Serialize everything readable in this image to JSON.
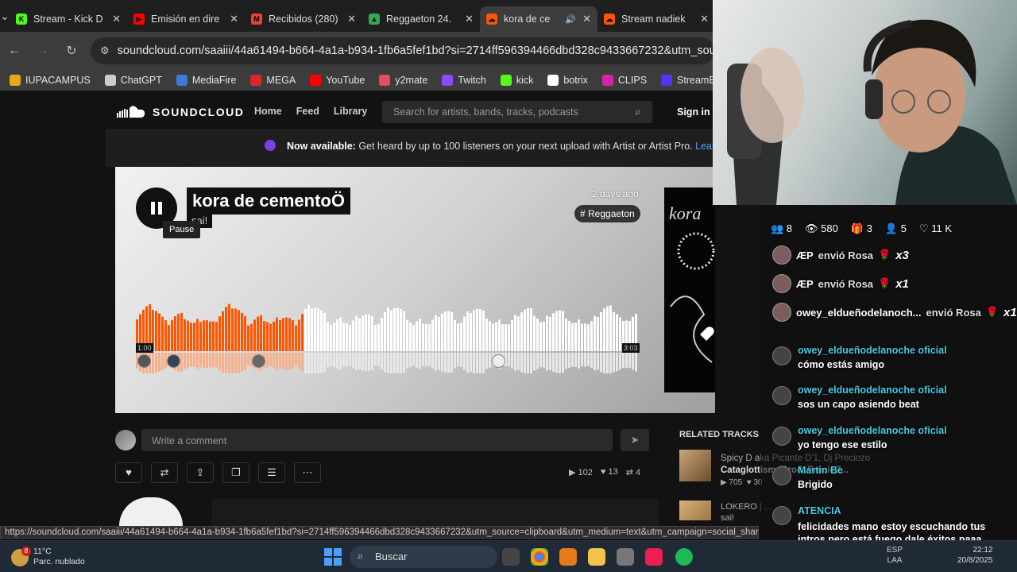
{
  "browser": {
    "tabs": [
      {
        "title": "Stream - Kick D",
        "color": "#53fc18",
        "glyph": "K"
      },
      {
        "title": "Emisión en dire",
        "color": "#ff0000",
        "glyph": "▶"
      },
      {
        "title": "Recibidos (280)",
        "color": "#ea4335",
        "glyph": "M"
      },
      {
        "title": "Reggaeton 24.",
        "color": "#34a853",
        "glyph": "▲"
      },
      {
        "title": "kora de ce",
        "color": "#ff5500",
        "glyph": "☁"
      },
      {
        "title": "Stream nadiek",
        "color": "#ff5500",
        "glyph": "☁"
      }
    ],
    "url": "soundcloud.com/saaiii/44a61494-b664-4a1a-b934-1fb6a5fef1bd?si=2714ff596394466dbd328c9433667232&utm_source",
    "bookmarks": [
      {
        "label": "IUPACAMPUS",
        "color": "#e6a817"
      },
      {
        "label": "ChatGPT",
        "color": "#cccccc"
      },
      {
        "label": "MediaFire",
        "color": "#3d7bd9"
      },
      {
        "label": "MEGA",
        "color": "#d9272e"
      },
      {
        "label": "YouTube",
        "color": "#ff0000"
      },
      {
        "label": "y2mate",
        "color": "#e84a5f"
      },
      {
        "label": "Twitch",
        "color": "#9146ff"
      },
      {
        "label": "kick",
        "color": "#53fc18"
      },
      {
        "label": "botrix",
        "color": "#ffffff"
      },
      {
        "label": "CLIPS",
        "color": "#d6249f"
      },
      {
        "label": "StreamElements",
        "color": "#5533ff"
      }
    ]
  },
  "soundcloud": {
    "logo": "SOUNDCLOUD",
    "nav": [
      "Home",
      "Feed",
      "Library"
    ],
    "search_placeholder": "Search for artists, bands, tracks, podcasts",
    "sign_in": "Sign in",
    "banner_bold": "Now available:",
    "banner_text": " Get heard by up to 100 listeners on your next upload with Artist or Artist Pro. ",
    "banner_link": "Learn M",
    "track": {
      "title": "kora de cementoÖ",
      "artist": "sai!",
      "uploaded": "2 days ago",
      "tag": "# Reggaeton",
      "tooltip": "Pause",
      "elapsed": "1:00",
      "duration": "3:03",
      "progress": 0.33
    },
    "comment_placeholder": "Write a comment",
    "stats": {
      "plays": "102",
      "likes": "13",
      "reposts": "4"
    },
    "related_header": "RELATED TRACKS",
    "related": [
      {
        "artist": "Spicy D aka Picante D'1, Dj Preciozo",
        "title": "Cataglottism (Prod. PrecioZ...",
        "plays": "705",
        "likes": "30"
      },
      {
        "artist": "LOKERO | ...",
        "title": "sai!"
      }
    ]
  },
  "status_url": "https://soundcloud.com/saaiii/44a61494-b664-4a1a-b934-1fb6a5fef1bd?si=2714ff596394466dbd328c9433667232&utm_source=clipboard&utm_medium=text&utm_campaign=social_sharing",
  "taskbar": {
    "temp": "11°C",
    "weather": "Parc. nublado",
    "notif_count": "8",
    "search": "Buscar",
    "lang": "ESP",
    "region": "LAA",
    "time": "22:12",
    "date": "20/8/2025"
  },
  "stream_overlay": {
    "viewers": "8",
    "views": "580",
    "gifts": "3",
    "follows": "5",
    "likes": "11 K",
    "gift_events": [
      {
        "user": "ÆP",
        "text": "envió Rosa",
        "mult": "x3"
      },
      {
        "user": "ÆP",
        "text": "envió Rosa",
        "mult": "x1"
      },
      {
        "user": "owey_eldueñodelanoch...",
        "text": "envió Rosa",
        "mult": "x1"
      }
    ],
    "messages": [
      {
        "user": "owey_eldueñodelanoche oficial",
        "text": "cómo estás amigo"
      },
      {
        "user": "owey_eldueñodelanoche oficial",
        "text": "sos un capo asiendo beat"
      },
      {
        "user": "owey_eldueñodelanoche oficial",
        "text": "yo tengo ese estilo"
      },
      {
        "user": "Martin Be",
        "text": "Brigido"
      },
      {
        "user": "ATENCIA",
        "text": "felicidades mano estoy escuchando tus intros pero está fuego dale éxitos paaa"
      }
    ]
  }
}
